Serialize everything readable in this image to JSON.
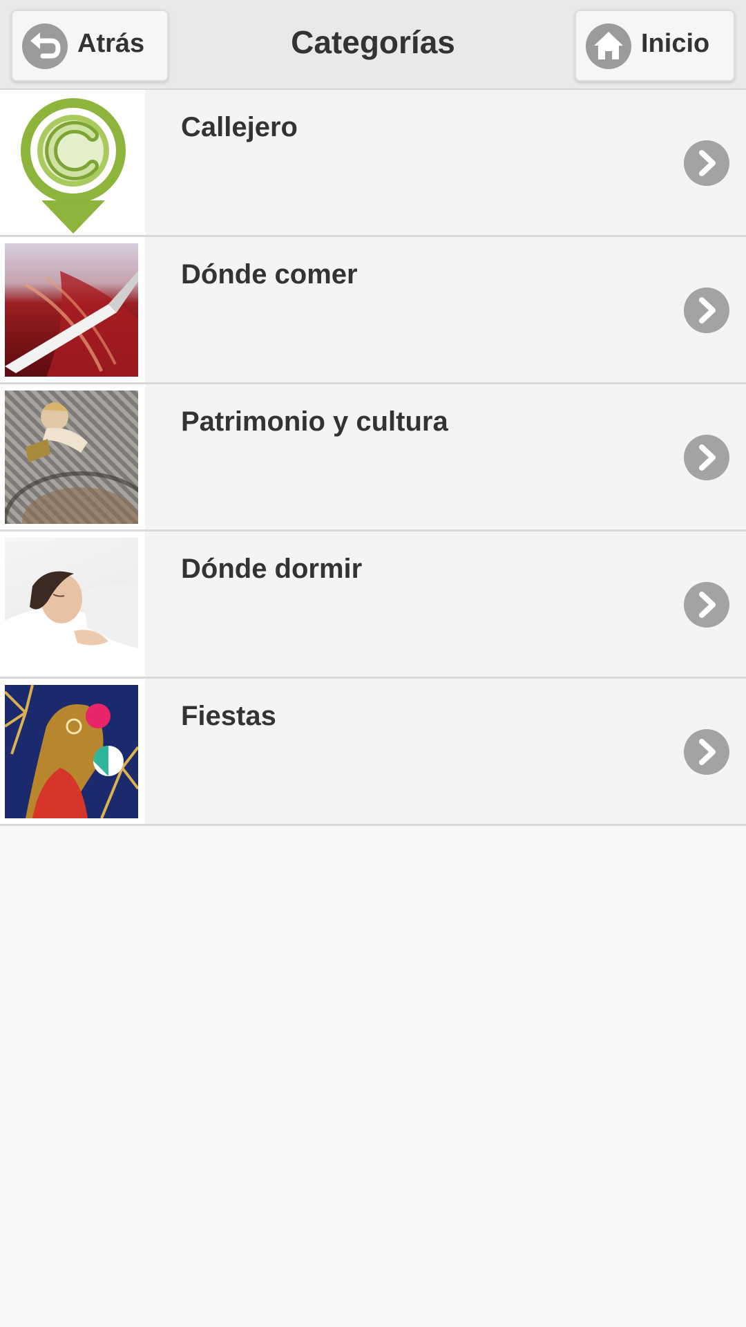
{
  "header": {
    "title": "Categorías",
    "back_label": "Atrás",
    "home_label": "Inicio"
  },
  "categories": [
    {
      "label": "Callejero"
    },
    {
      "label": "Dónde comer"
    },
    {
      "label": "Patrimonio y cultura"
    },
    {
      "label": "Dónde dormir"
    },
    {
      "label": "Fiestas"
    }
  ],
  "colors": {
    "header_bg": "#e9e9e9",
    "row_bg": "#f4f4f4",
    "text": "#333333",
    "icon_circle": "#9b9b9b",
    "logo_green": "#8db43b"
  }
}
